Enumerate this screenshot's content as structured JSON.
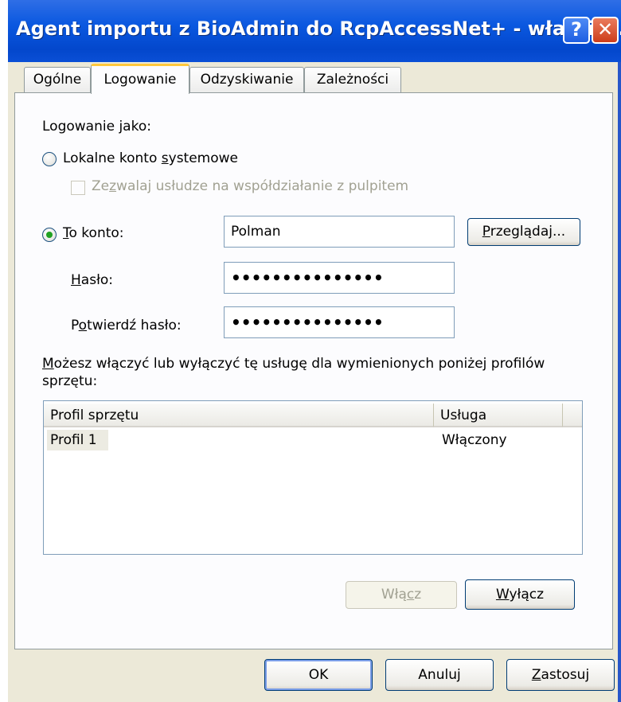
{
  "window": {
    "title": "Agent importu z BioAdmin do RcpAccessNet+ - właściw...",
    "help_label": "?",
    "close_label": "✕"
  },
  "tabs": [
    {
      "label": "Ogólne",
      "active": false
    },
    {
      "label": "Logowanie",
      "active": true
    },
    {
      "label": "Odzyskiwanie",
      "active": false
    },
    {
      "label": "Zależności",
      "active": false
    }
  ],
  "logon": {
    "heading": "Logowanie jako:",
    "local_system": {
      "pre": "Lokalne konto ",
      "accel": "s",
      "post": "ystemowe",
      "selected": false
    },
    "interact_desktop": {
      "pre": "Ze",
      "accel": "z",
      "post": "walaj usłudze na współdziałanie z pulpitem",
      "checked": false,
      "enabled": false
    },
    "this_account": {
      "accel": "T",
      "post": "o konto:",
      "selected": true,
      "value": "Polman"
    },
    "browse_button": {
      "accel": "P",
      "post": "rzeglądaj..."
    },
    "password": {
      "accel": "H",
      "post": "asło:",
      "value": "•••••••••••••••"
    },
    "confirm_password": {
      "pre": "P",
      "accel": "o",
      "post": "twierdź hasło:",
      "value": "•••••••••••••••"
    }
  },
  "profiles": {
    "description": {
      "accel": "M",
      "line1": "ożesz włączyć lub wyłączyć tę usługę dla wymienionych poniżej profilów",
      "line2": "sprzętu:"
    },
    "columns": [
      "Profil sprzętu",
      "Usługa"
    ],
    "rows": [
      {
        "profile": "Profil 1",
        "service": "Włączony"
      }
    ],
    "enable_button": {
      "pre": "Włą",
      "accel": "c",
      "post": "z",
      "enabled": false
    },
    "disable_button": {
      "accel": "W",
      "post": "yłącz",
      "enabled": true
    }
  },
  "footer": {
    "ok": "OK",
    "cancel": "Anuluj",
    "apply": {
      "accel": "Z",
      "post": "astosuj"
    }
  },
  "colors": {
    "title_bar": "#0a58e0",
    "dialog_bg": "#ece9d8",
    "active_tab_accent": "#ffc83c",
    "radio_dot": "#21a121"
  }
}
